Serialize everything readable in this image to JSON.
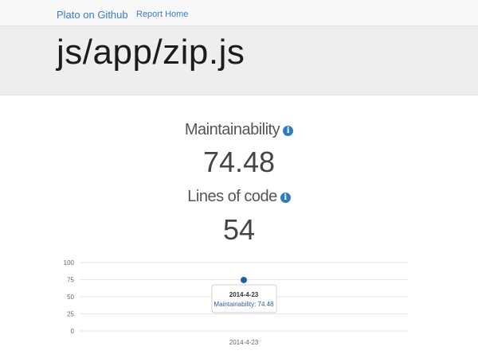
{
  "navbar": {
    "brand_label": "Plato on Github",
    "home_label": "Report Home"
  },
  "header": {
    "title": "js/app/zip.js"
  },
  "stats": {
    "maintainability_label": "Maintainability",
    "maintainability_value": "74.48",
    "loc_label": "Lines of code",
    "loc_value": "54",
    "info_icon": "info-icon"
  },
  "colors": {
    "link": "#3b7cc4",
    "point": "#1f5fa8",
    "grid": "#e6e6e6"
  },
  "chart_data": {
    "type": "line",
    "x": [
      "2014-4-23"
    ],
    "series": [
      {
        "values": [
          74.48
        ]
      }
    ],
    "ylim": [
      0,
      100
    ],
    "yticks": [
      0,
      25,
      50,
      75,
      100
    ],
    "grid": true,
    "tooltip": {
      "title": "2014-4-23",
      "text": "Maintainability: 74.48"
    }
  }
}
